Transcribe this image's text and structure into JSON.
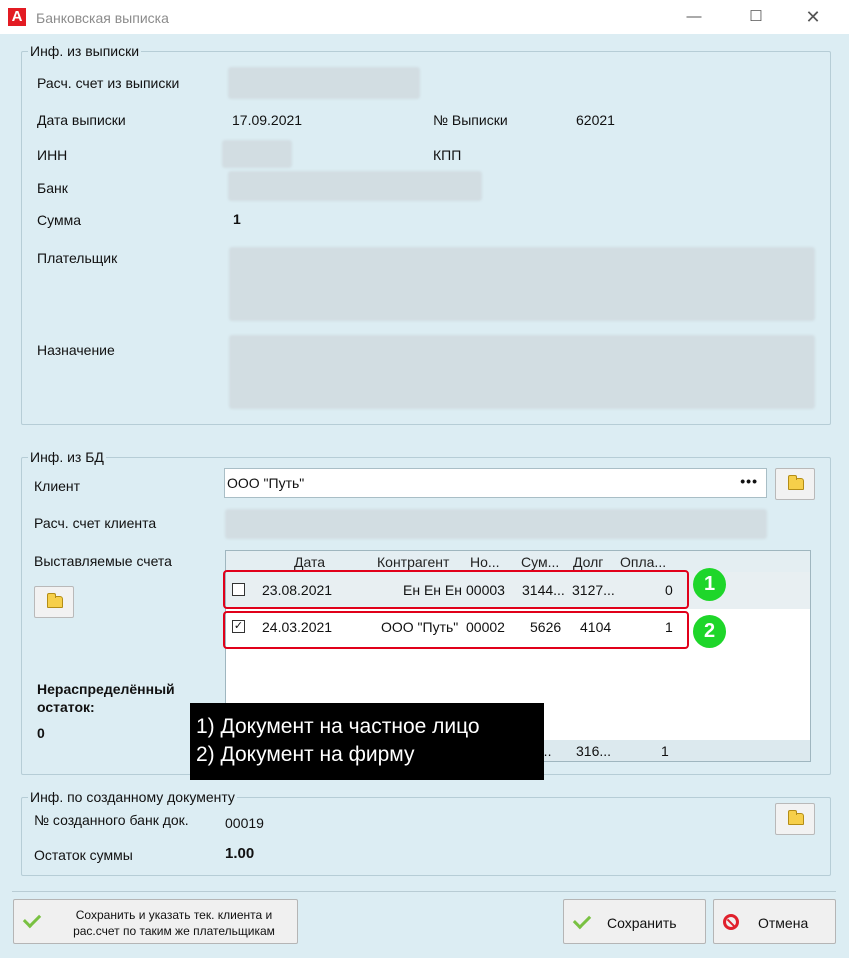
{
  "window": {
    "title": "Банковская выписка",
    "logo_letter": "A",
    "minimize": "—",
    "maximize": "☐",
    "close": "✕"
  },
  "statement": {
    "legend": "Инф. из выписки",
    "account_label": "Расч. счет из выписки",
    "date_label": "Дата выписки",
    "date_value": "17.09.2021",
    "number_label": "№ Выписки",
    "number_value": "62021",
    "inn_label": "ИНН",
    "kpp_label": "КПП",
    "bank_label": "Банк",
    "sum_label": "Сумма",
    "sum_value": "1",
    "payer_label": "Плательщик",
    "purpose_label": "Назначение"
  },
  "db": {
    "legend": "Инф. из БД",
    "client_label": "Клиент",
    "client_value": "ООО \"Путь\"",
    "client_dots": "•••",
    "client_account_label": "Расч. счет клиента",
    "invoices_label": "Выставляемые счета",
    "unallocated_label": "Нераспределённый остаток:",
    "unallocated_value": "0",
    "grid": {
      "headers": [
        "Дата",
        "Контрагент",
        "Но...",
        "Сум...",
        "Долг",
        "Опла..."
      ],
      "rows": [
        {
          "check": "",
          "date": "23.08.2021",
          "contractor": "Ен Ен Ен",
          "number": "00003",
          "sum": "3144...",
          "debt": "3127...",
          "paid": "0"
        },
        {
          "check": "✓",
          "date": "24.03.2021",
          "contractor": "ООО \"Путь\"",
          "number": "00002",
          "sum": "5626",
          "debt": "4104",
          "paid": "1"
        }
      ],
      "footer": {
        "sum": "0...",
        "debt": "316...",
        "paid": "1"
      }
    }
  },
  "annotations": {
    "badge1": "1",
    "badge2": "2",
    "tooltip_line1": "1) Документ на частное лицо",
    "tooltip_line2": "2) Документ на фирму"
  },
  "created": {
    "legend": "Инф. по созданному документу",
    "doc_number_label": "№ созданного банк док.",
    "doc_number_value": "00019",
    "remaining_label": "Остаток суммы",
    "remaining_value": "1.00"
  },
  "buttons": {
    "save_and_set": "Сохранить и указать тек. клиента и рас.счет по таким же плательщикам",
    "save": "Сохранить",
    "cancel": "Отмена"
  }
}
